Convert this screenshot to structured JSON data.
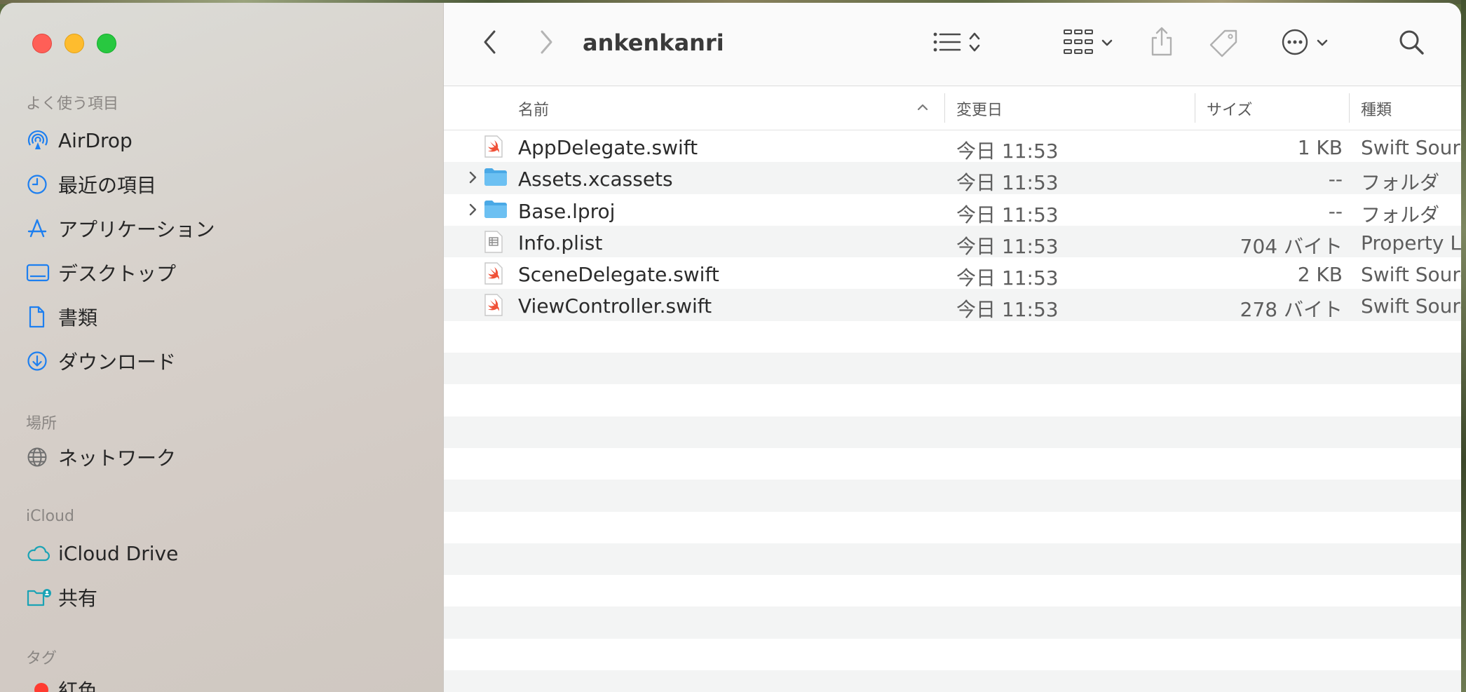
{
  "window": {
    "title": "ankenkanri"
  },
  "sidebar": {
    "favorites_heading": "よく使う項目",
    "favorites": [
      {
        "label": "AirDrop",
        "icon": "airdrop-icon"
      },
      {
        "label": "最近の項目",
        "icon": "clock-icon"
      },
      {
        "label": "アプリケーション",
        "icon": "applications-icon"
      },
      {
        "label": "デスクトップ",
        "icon": "desktop-icon"
      },
      {
        "label": "書類",
        "icon": "document-icon"
      },
      {
        "label": "ダウンロード",
        "icon": "download-icon"
      }
    ],
    "locations_heading": "場所",
    "locations": [
      {
        "label": "ネットワーク",
        "icon": "network-icon"
      }
    ],
    "icloud_heading": "iCloud",
    "icloud": [
      {
        "label": "iCloud Drive",
        "icon": "cloud-icon"
      },
      {
        "label": "共有",
        "icon": "shared-folder-icon"
      }
    ],
    "tags_heading": "タグ",
    "tags": [
      {
        "label": "紅色",
        "color": "#ff3b30"
      }
    ]
  },
  "columns": {
    "name": "名前",
    "date": "変更日",
    "size": "サイズ",
    "kind": "種類"
  },
  "files": [
    {
      "name": "AppDelegate.swift",
      "date": "今日 11:53",
      "size": "1 KB",
      "kind": "Swift Source",
      "type": "swift",
      "expandable": false
    },
    {
      "name": "Assets.xcassets",
      "date": "今日 11:53",
      "size": "--",
      "kind": "フォルダ",
      "type": "folder",
      "expandable": true
    },
    {
      "name": "Base.lproj",
      "date": "今日 11:53",
      "size": "--",
      "kind": "フォルダ",
      "type": "folder",
      "expandable": true
    },
    {
      "name": "Info.plist",
      "date": "今日 11:53",
      "size": "704 バイト",
      "kind": "Property List",
      "type": "plist",
      "expandable": false
    },
    {
      "name": "SceneDelegate.swift",
      "date": "今日 11:53",
      "size": "2 KB",
      "kind": "Swift Source",
      "type": "swift",
      "expandable": false
    },
    {
      "name": "ViewController.swift",
      "date": "今日 11:53",
      "size": "278 バイト",
      "kind": "Swift Source",
      "type": "swift",
      "expandable": false
    }
  ],
  "colors": {
    "accent": "#0a7aff",
    "folder": "#5ab8f0",
    "swift": "#f05138",
    "tag_red": "#ff3b30"
  }
}
